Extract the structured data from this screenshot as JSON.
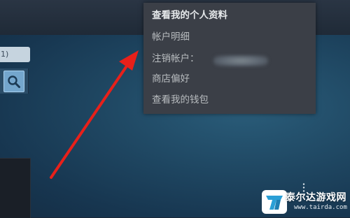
{
  "sidebar": {
    "tab_label": "1)"
  },
  "dropdown": {
    "items": [
      {
        "label": "查看我的个人资料"
      },
      {
        "label": "帐户明细"
      },
      {
        "label": "注销帐户："
      },
      {
        "label": "商店偏好"
      },
      {
        "label": "查看我的钱包"
      }
    ]
  },
  "watermark": {
    "name": "泰尔达游戏网",
    "url": "www.tairda.com"
  },
  "colors": {
    "dropdown_bg": "#3b3f47",
    "arrow": "#e8201a",
    "background": "#1e4560"
  },
  "icons": [
    "search-icon",
    "red-arrow-annotation",
    "site-logo-icon"
  ]
}
